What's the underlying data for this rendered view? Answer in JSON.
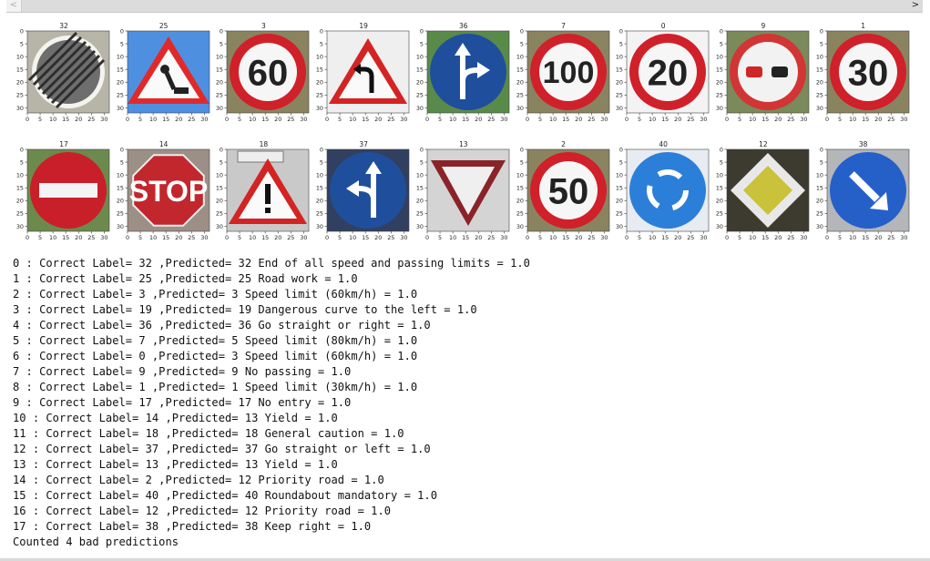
{
  "scrollbar": {
    "left_arrow_icon": "chevron-left-icon",
    "right_arrow_icon": "chevron-right-icon",
    "left_glyph": "<",
    "right_glyph": ">"
  },
  "figure": {
    "tick_labels": [
      "0",
      "5",
      "10",
      "15",
      "20",
      "25",
      "30"
    ],
    "images": [
      {
        "title": "32",
        "sign": "end-of-limits"
      },
      {
        "title": "25",
        "sign": "road-work"
      },
      {
        "title": "3",
        "sign": "speed-limit",
        "text": "60"
      },
      {
        "title": "19",
        "sign": "curve"
      },
      {
        "title": "36",
        "sign": "straight-or-right"
      },
      {
        "title": "7",
        "sign": "speed-limit",
        "text": "100"
      },
      {
        "title": "0",
        "sign": "speed-limit",
        "text": "20"
      },
      {
        "title": "9",
        "sign": "no-passing"
      },
      {
        "title": "1",
        "sign": "speed-limit",
        "text": "30"
      },
      {
        "title": "17",
        "sign": "no-entry"
      },
      {
        "title": "14",
        "sign": "stop",
        "text": "STOP"
      },
      {
        "title": "18",
        "sign": "caution"
      },
      {
        "title": "37",
        "sign": "straight-or-left"
      },
      {
        "title": "13",
        "sign": "yield"
      },
      {
        "title": "2",
        "sign": "speed-limit",
        "text": "50"
      },
      {
        "title": "40",
        "sign": "roundabout"
      },
      {
        "title": "12",
        "sign": "priority"
      },
      {
        "title": "38",
        "sign": "keep-right"
      }
    ]
  },
  "output_lines": [
    "0 : Correct Label= 32 ,Predicted= 32 End of all speed and passing limits = 1.0",
    "1 : Correct Label= 25 ,Predicted= 25 Road work = 1.0",
    "2 : Correct Label= 3 ,Predicted= 3 Speed limit (60km/h) = 1.0",
    "3 : Correct Label= 19 ,Predicted= 19 Dangerous curve to the left = 1.0",
    "4 : Correct Label= 36 ,Predicted= 36 Go straight or right = 1.0",
    "5 : Correct Label= 7 ,Predicted= 5 Speed limit (80km/h) = 1.0",
    "6 : Correct Label= 0 ,Predicted= 3 Speed limit (60km/h) = 1.0",
    "7 : Correct Label= 9 ,Predicted= 9 No passing = 1.0",
    "8 : Correct Label= 1 ,Predicted= 1 Speed limit (30km/h) = 1.0",
    "9 : Correct Label= 17 ,Predicted= 17 No entry = 1.0",
    "10 : Correct Label= 14 ,Predicted= 13 Yield = 1.0",
    "11 : Correct Label= 18 ,Predicted= 18 General caution = 1.0",
    "12 : Correct Label= 37 ,Predicted= 37 Go straight or left = 1.0",
    "13 : Correct Label= 13 ,Predicted= 13 Yield = 1.0",
    "14 : Correct Label= 2 ,Predicted= 12 Priority road = 1.0",
    "15 : Correct Label= 40 ,Predicted= 40 Roundabout mandatory = 1.0",
    "16 : Correct Label= 12 ,Predicted= 12 Priority road = 1.0",
    "17 : Correct Label= 38 ,Predicted= 38 Keep right = 1.0",
    "Counted 4 bad predictions"
  ]
}
